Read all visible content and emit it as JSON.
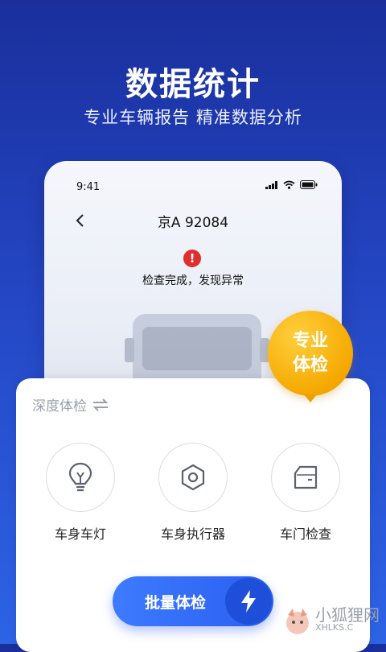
{
  "hero": {
    "title": "数据统计",
    "subtitle": "专业车辆报告  精准数据分析"
  },
  "phone": {
    "status_time": "9:41",
    "plate": "京A 92084",
    "alert_text": "检查完成，发现异常",
    "icons": [
      "signal-icon",
      "wifi-icon",
      "battery-icon",
      "back-chevron-icon",
      "alert-icon"
    ]
  },
  "badge": {
    "line1": "专业",
    "line2": "体检",
    "color": "#f5a900"
  },
  "card": {
    "title": "深度体检",
    "title_icon": "swap-arrows-icon",
    "features": [
      {
        "label": "车身车灯",
        "icon": "bulb-icon"
      },
      {
        "label": "车身执行器",
        "icon": "hexagon-icon"
      },
      {
        "label": "车门检查",
        "icon": "door-icon"
      }
    ]
  },
  "batch_button": {
    "label": "批量体检",
    "icon": "lightning-icon"
  },
  "watermark": {
    "cn": "小狐狸网",
    "en": "XHLKS.C"
  },
  "colors": {
    "bg_top": "#1a2f9c",
    "bg_bottom": "#2d63e6",
    "button": "#2a5ef0",
    "alert": "#e02d2d"
  }
}
